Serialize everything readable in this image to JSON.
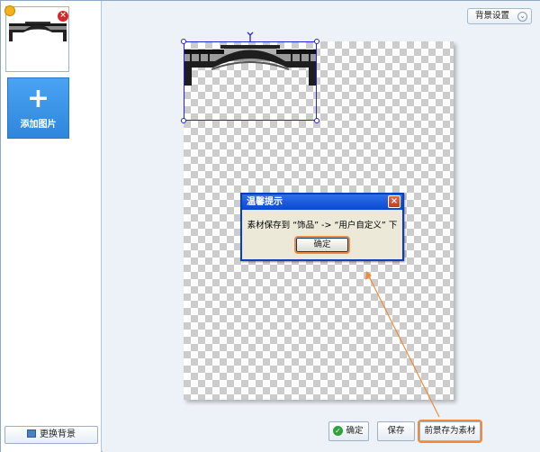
{
  "sidebar": {
    "add_image_label": "添加图片",
    "add_image_plus": "+",
    "change_background_label": "更换背景",
    "thumbnail_delete_glyph": "×"
  },
  "toolbar": {
    "background_settings_label": "背景设置",
    "background_settings_chevron": "⌄"
  },
  "dialog": {
    "title": "温馨提示",
    "close_glyph": "×",
    "message": "素材保存到 “饰品” -> “用户自定义” 下",
    "ok_label": "确定"
  },
  "actions": {
    "confirm_label": "确定",
    "confirm_icon_glyph": "✓",
    "save_label": "保存",
    "save_as_asset_label": "前景存为素材"
  },
  "colors": {
    "accent_blue": "#2f86dc",
    "highlight_orange": "#f08a3c",
    "selection_blue": "#2424d9",
    "dialog_title_blue": "#0a48d0"
  }
}
